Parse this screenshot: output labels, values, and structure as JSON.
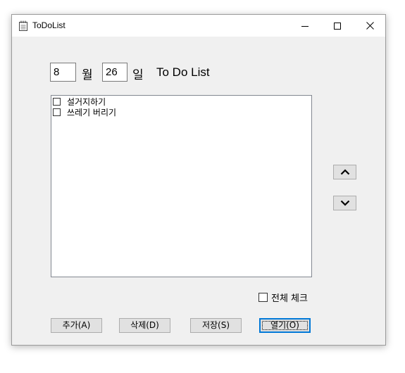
{
  "window": {
    "title": "ToDoList",
    "minimize_icon": "minimize-icon",
    "maximize_icon": "maximize-icon",
    "close_icon": "close-icon"
  },
  "date": {
    "month_value": "8",
    "month_label": "월",
    "day_value": "26",
    "day_label": "일"
  },
  "heading": "To Do List",
  "todo_items": [
    {
      "label": "설거지하기",
      "checked": false
    },
    {
      "label": "쓰레기 버리기",
      "checked": false
    }
  ],
  "move": {
    "up_icon": "chevron-up-icon",
    "down_icon": "chevron-down-icon"
  },
  "check_all": {
    "label": "전체 체크",
    "checked": false
  },
  "buttons": {
    "add": "추가(A)",
    "delete": "삭제(D)",
    "save": "저장(S)",
    "open": "열기(O)"
  }
}
